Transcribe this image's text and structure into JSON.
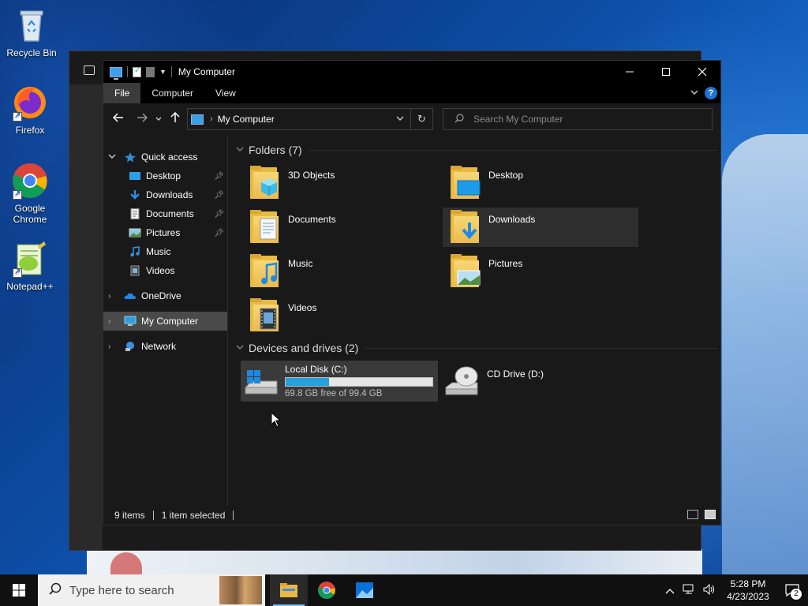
{
  "desktop": {
    "icons": [
      {
        "label": "Recycle Bin"
      },
      {
        "label": "Firefox"
      },
      {
        "label": "Google Chrome"
      },
      {
        "label": "Notepad++"
      }
    ]
  },
  "window": {
    "title": "My Computer",
    "ribbon_tabs": [
      "File",
      "Computer",
      "View"
    ],
    "address": {
      "crumb": "My Computer"
    },
    "search": {
      "placeholder": "Search My Computer"
    }
  },
  "sidebar": {
    "quick_access": "Quick access",
    "items": [
      {
        "label": "Desktop"
      },
      {
        "label": "Downloads"
      },
      {
        "label": "Documents"
      },
      {
        "label": "Pictures"
      },
      {
        "label": "Music"
      },
      {
        "label": "Videos"
      }
    ],
    "onedrive": "OneDrive",
    "my_computer": "My Computer",
    "network": "Network"
  },
  "folders": {
    "header": "Folders (7)",
    "items": [
      {
        "label": "3D Objects"
      },
      {
        "label": "Desktop"
      },
      {
        "label": "Documents"
      },
      {
        "label": "Downloads"
      },
      {
        "label": "Music"
      },
      {
        "label": "Pictures"
      },
      {
        "label": "Videos"
      }
    ]
  },
  "drives": {
    "header": "Devices and drives (2)",
    "items": [
      {
        "label": "Local Disk (C:)",
        "free_text": "69.8 GB free of 99.4 GB",
        "used_fraction": 0.298
      },
      {
        "label": "CD Drive (D:)"
      }
    ]
  },
  "status": {
    "items": "9 items",
    "selected": "1 item selected"
  },
  "taskbar": {
    "search_placeholder": "Type here to search",
    "time": "5:28 PM",
    "date": "4/23/2023",
    "notifications": "2"
  },
  "colors": {
    "accent": "#26a0da",
    "selection": "#4a4a4a",
    "folder": "#e8b944"
  }
}
